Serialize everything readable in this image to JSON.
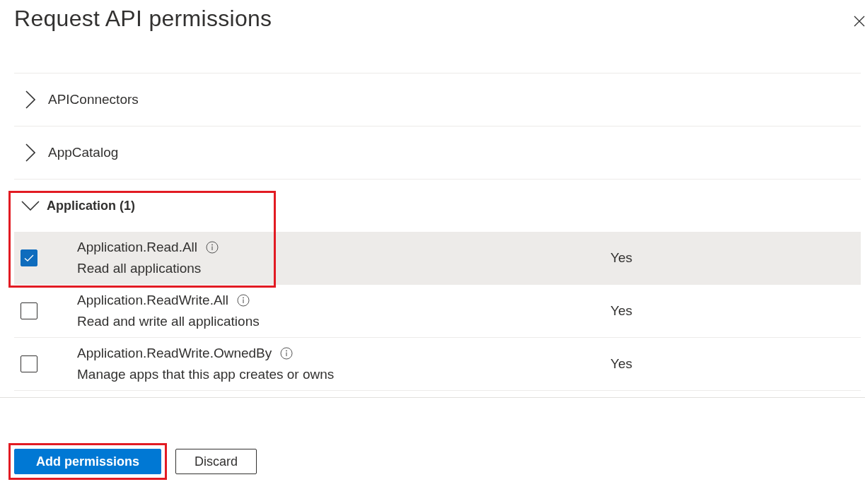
{
  "panel": {
    "title": "Request API permissions"
  },
  "groups": [
    {
      "label": "APIConnectors",
      "expanded": false,
      "highlighted": false
    },
    {
      "label": "AppCatalog",
      "expanded": false,
      "highlighted": false
    },
    {
      "label": "Application (1)",
      "expanded": true,
      "highlighted": true,
      "permissions": [
        {
          "name": "Application.Read.All",
          "description": "Read all applications",
          "admin_consent": "Yes",
          "checked": true
        },
        {
          "name": "Application.ReadWrite.All",
          "description": "Read and write all applications",
          "admin_consent": "Yes",
          "checked": false
        },
        {
          "name": "Application.ReadWrite.OwnedBy",
          "description": "Manage apps that this app creates or owns",
          "admin_consent": "Yes",
          "checked": false
        }
      ]
    }
  ],
  "buttons": [
    {
      "label": "Add permissions",
      "kind": "primary",
      "highlighted": true
    },
    {
      "label": "Discard",
      "kind": "secondary",
      "highlighted": false
    }
  ]
}
